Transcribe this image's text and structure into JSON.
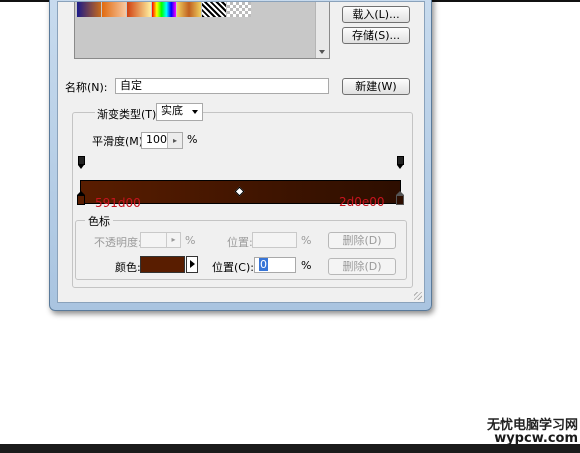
{
  "dialog": {
    "load_button": "载入(L)...",
    "save_button": "存储(S)...",
    "name_label": "名称(N):",
    "name_value": "自定",
    "new_button": "新建(W)",
    "gradient_type_label": "渐变类型(T):",
    "gradient_type_value": "实底",
    "smoothness_label": "平滑度(M):",
    "smoothness_value": "100",
    "smoothness_unit": "%"
  },
  "gradient": {
    "start_color": "#591d00",
    "end_color": "#2d0e00",
    "start_label": "591d00",
    "end_label": "2d0e00",
    "midpoint_percent": 50
  },
  "color_stops": {
    "group_title": "色标",
    "opacity_label": "不透明度:",
    "opacity_unit": "%",
    "opacity_location_label": "位置:",
    "opacity_location_unit": "%",
    "opacity_delete": "删除(D)",
    "color_label": "颜色:",
    "color_value": "#591d00",
    "location_label": "位置(C):",
    "location_value": "0",
    "location_unit": "%",
    "color_delete": "删除(D)"
  },
  "watermark": {
    "line1": "无忧电脑学习网",
    "line2": "wypcw.com"
  }
}
